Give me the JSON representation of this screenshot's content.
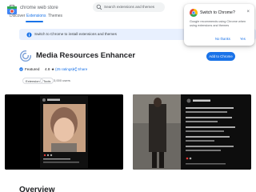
{
  "header": {
    "logo_text": "chrome web store",
    "search_placeholder": "Search extensions and themes",
    "tabs": [
      "Discover",
      "Extensions",
      "Themes"
    ],
    "active_tab": "Extensions"
  },
  "banner": {
    "text": "Switch to Chrome to install extensions and themes"
  },
  "popup": {
    "title": "Switch to Chrome?",
    "body": "Google recommends using Chrome when using extensions and themes",
    "no_label": "No thanks",
    "yes_label": "Yes"
  },
  "extension": {
    "title": "Media Resources Enhancer",
    "add_label": "Add to Chrome",
    "featured_label": "Featured",
    "rating": "4.8",
    "star": "★",
    "ratings_link": "(25 ratings)",
    "share_label": "Share",
    "chips": [
      "Extension",
      "Tools"
    ],
    "users": "3,000 users"
  },
  "section": {
    "overview": "Overview"
  },
  "colors": {
    "accent": "#1a73e8",
    "banner_bg": "#e8f0fe"
  }
}
